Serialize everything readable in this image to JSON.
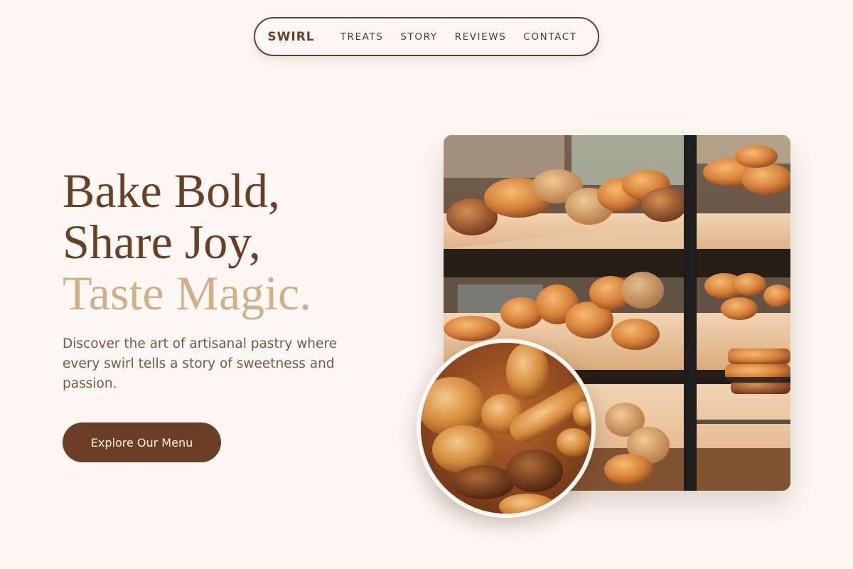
{
  "nav": {
    "brand": "SWIRL",
    "links": [
      {
        "label": "TREATS"
      },
      {
        "label": "STORY"
      },
      {
        "label": "REVIEWS"
      },
      {
        "label": "CONTACT"
      }
    ]
  },
  "hero": {
    "headline_line1": "Bake Bold,",
    "headline_line2": "Share Joy,",
    "headline_line3": "Taste Magic.",
    "description": "Discover the art of artisanal pastry where every swirl tells a story of sweetness and passion.",
    "cta_label": "Explore Our Menu"
  },
  "colors": {
    "background": "#fdf8f3",
    "primary_brown": "#6b3f25",
    "accent_tan": "#cfb08a",
    "body_text": "#7a5643"
  }
}
